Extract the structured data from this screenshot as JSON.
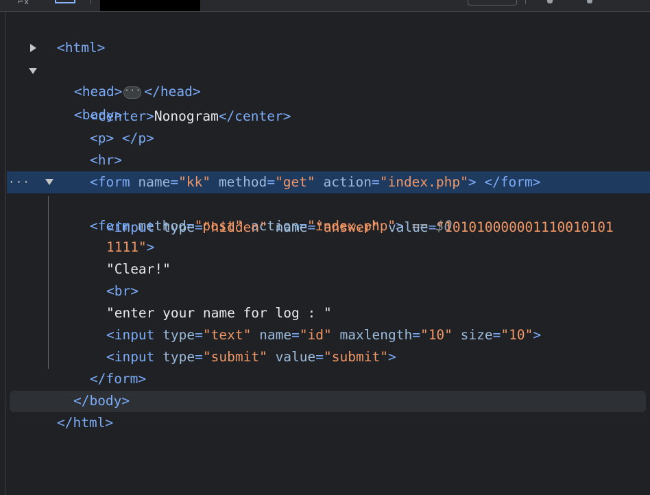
{
  "toolbar": {
    "inspect_icon": "inspect-element-icon",
    "device_icon": "device-toggle-icon"
  },
  "dom": {
    "html_open": "<html>",
    "head_open": "<head>",
    "head_close": "</head>",
    "head_ellipsis": "···",
    "body_open": "<body>",
    "center_open": "<center>",
    "center_text": "Nonogram",
    "center_close": "</center>",
    "p_line": "<p> </p>",
    "hr_line": "<hr>",
    "form1": {
      "tag": "<form",
      "attrs": [
        {
          "name": "name",
          "value": "\"kk\""
        },
        {
          "name": "method",
          "value": "\"get\""
        },
        {
          "name": "action",
          "value": "\"index.php\""
        }
      ],
      "end": "> </form>"
    },
    "form2": {
      "tag": "<form",
      "attrs": [
        {
          "name": "method",
          "value": "\"post\""
        },
        {
          "name": "action",
          "value": "\"index.php\""
        }
      ],
      "end": ">",
      "selected_marker": " == ",
      "selected_var": "$0",
      "row_dots": "···"
    },
    "input_hidden": {
      "tag": "<input",
      "type_attr": "type",
      "type_val": "\"hidden\"",
      "name_attr": "name",
      "name_val": "\"answer\"",
      "value_attr": "value",
      "value_val_line1": "\"101010000001110010101",
      "value_val_line2": "1111\"",
      "end": ">"
    },
    "text_clear": "\"Clear!\"",
    "br_line": "<br>",
    "text_enter": "\"enter your name for log : \"",
    "input_text": {
      "tag": "<input",
      "type_attr": "type",
      "type_val": "\"text\"",
      "name_attr": "name",
      "name_val": "\"id\"",
      "maxlength_attr": "maxlength",
      "maxlength_val": "\"10\"",
      "size_attr": "size",
      "size_val": "\"10\"",
      "end": ">"
    },
    "input_submit": {
      "tag": "<input",
      "type_attr": "type",
      "type_val": "\"submit\"",
      "value_attr": "value",
      "value_val": "\"submit\"",
      "end": ">"
    },
    "form_close": "</form>",
    "body_close": "</body>",
    "html_close": "</html>"
  }
}
